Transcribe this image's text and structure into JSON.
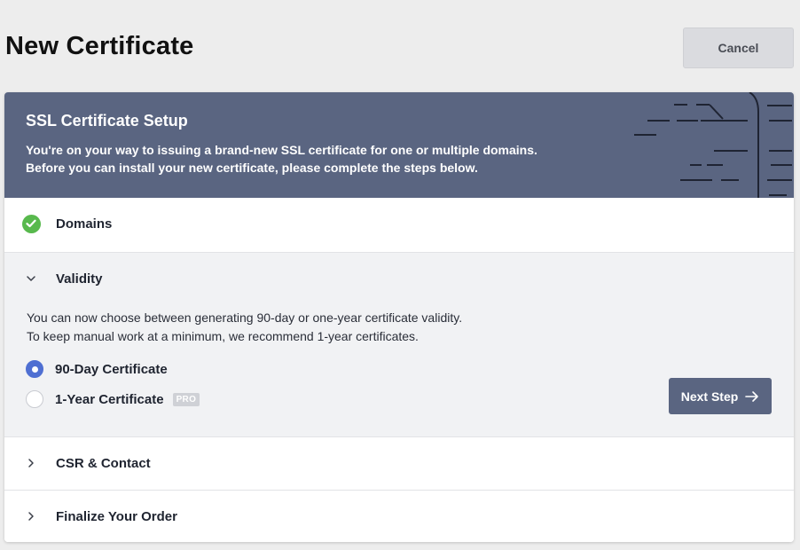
{
  "header": {
    "title": "New Certificate",
    "cancel_label": "Cancel"
  },
  "banner": {
    "title": "SSL Certificate Setup",
    "line1": "You're on your way to issuing a brand-new SSL certificate for one or multiple domains.",
    "line2": "Before you can install your new certificate, please complete the steps below."
  },
  "steps": {
    "domains": {
      "label": "Domains",
      "status": "completed"
    },
    "validity": {
      "label": "Validity",
      "status": "expanded",
      "text1": "You can now choose between generating 90-day or one-year certificate validity.",
      "text2": "To keep manual work at a minimum, we recommend 1-year certificates.",
      "options": [
        {
          "label": "90-Day Certificate",
          "selected": true
        },
        {
          "label": "1-Year Certificate",
          "selected": false,
          "badge": "PRO"
        }
      ],
      "next_label": "Next Step"
    },
    "csr": {
      "label": "CSR & Contact",
      "status": "collapsed"
    },
    "finalize": {
      "label": "Finalize Your Order",
      "status": "collapsed"
    }
  },
  "colors": {
    "banner": "#5a6581",
    "success": "#58b94d",
    "radio_selected": "#4f6fd2",
    "expanded_bg": "#f1f2f4"
  }
}
